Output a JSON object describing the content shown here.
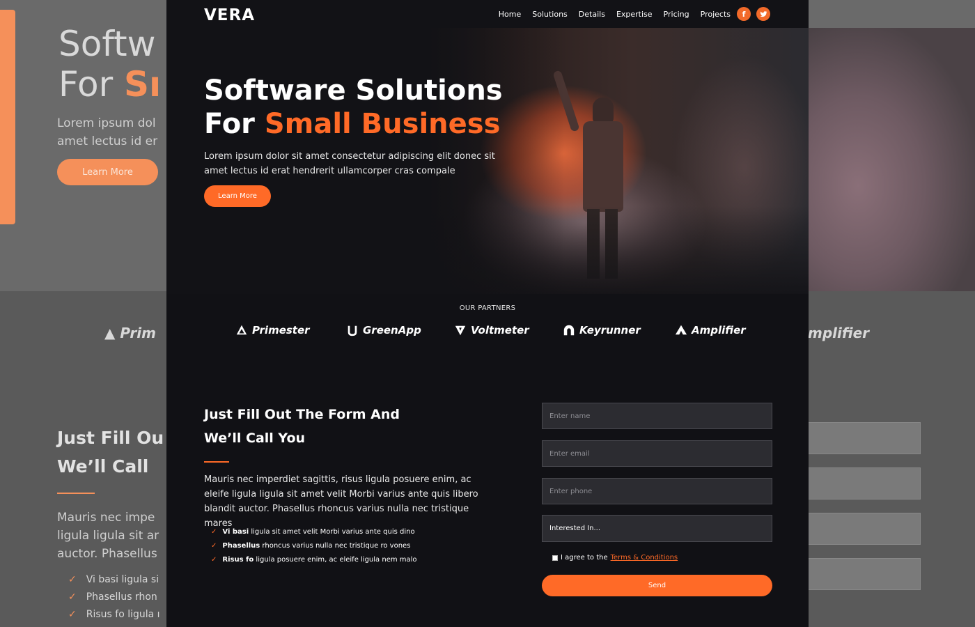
{
  "brand": "VERA",
  "nav": [
    "Home",
    "Solutions",
    "Details",
    "Expertise",
    "Pricing",
    "Projects"
  ],
  "social": {
    "facebook": "f",
    "twitter": "t"
  },
  "hero": {
    "title_line1": "Software Solutions",
    "title_line2_prefix": "For ",
    "title_line2_accent": "Small Business",
    "text": "Lorem ipsum dolor sit amet consectetur adipiscing elit donec sit amet lectus id erat hendrerit ullamcorper cras compale",
    "cta": "Learn More"
  },
  "partners": {
    "title": "OUR PARTNERS",
    "logos": [
      "Primester",
      "GreenApp",
      "Voltmeter",
      "Keyrunner",
      "Amplifier"
    ]
  },
  "contact": {
    "title_line1": "Just Fill Out The Form And",
    "title_line2": "We’ll Call You",
    "text": "Mauris nec imperdiet sagittis, risus ligula posuere enim, ac eleife ligula ligula sit amet velit Morbi varius ante quis libero blandit auctor. Phasellus rhoncus varius nulla nec tristique mares",
    "items": [
      {
        "bold": "Vi basi",
        "text": " ligula sit amet velit Morbi varius ante quis dino"
      },
      {
        "bold": "Phasellus",
        "text": " rhoncus varius nulla nec tristique ro vones"
      },
      {
        "bold": "Risus fo",
        "text": " ligula posuere enim, ac eleife ligula nem malo"
      }
    ]
  },
  "form": {
    "name_placeholder": "Enter name",
    "email_placeholder": "Enter email",
    "phone_placeholder": "Enter phone",
    "interest": "Interested In...",
    "agree_text": "I agree to the ",
    "agree_link": "Terms & Conditions",
    "send": "Send"
  },
  "background": {
    "title_line1": "Softw",
    "title_line2_prefix": "For ",
    "title_line2_accent": "Sı",
    "text_line1": "Lorem ipsum dol",
    "text_line2": "amet lectus id er",
    "cta": "Learn More",
    "logo_left": "Prim",
    "logo_right": "mplifier",
    "heading_line1": "Just Fill Ou",
    "heading_line2": "We’ll Call ",
    "para_line1": "Mauris nec impe",
    "para_line2": "ligula ligula sit ar",
    "para_line3": "auctor. Phasellus",
    "item1": "Vi basi ligula si",
    "item2": "Phasellus rhon",
    "item3": "Risus fo ligula ı"
  },
  "colors": {
    "accent": "#ff6a27",
    "frame_bg": "#111115",
    "field_bg": "#2c2c31"
  }
}
